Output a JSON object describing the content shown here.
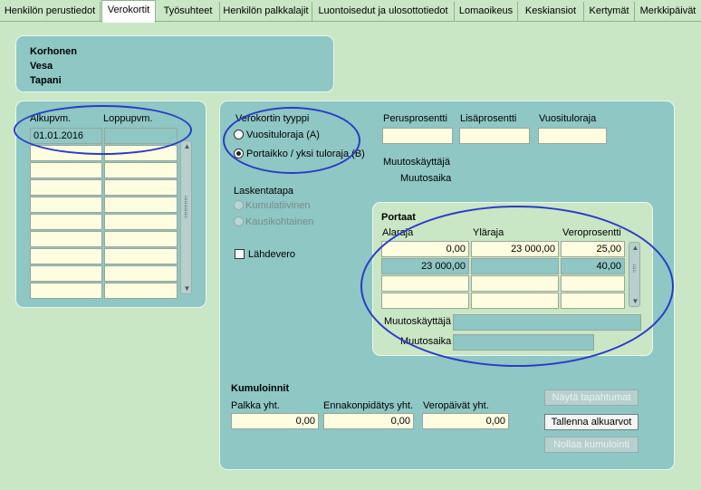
{
  "tabs": [
    {
      "label": "Henkilön perustiedot"
    },
    {
      "label": "Verokortit"
    },
    {
      "label": "Työsuhteet"
    },
    {
      "label": "Henkilön palkkalajit"
    },
    {
      "label": "Luontoisedut ja ulosottotiedot"
    },
    {
      "label": "Lomaoikeus"
    },
    {
      "label": "Keskiansiot"
    },
    {
      "label": "Kertymät"
    },
    {
      "label": "Merkkipäivät"
    }
  ],
  "active_tab": "Verokortit",
  "person": {
    "last_name": "Korhonen",
    "first_name": "Vesa",
    "second_name": "Tapani"
  },
  "cards_list": {
    "col_start": "Alkupvm.",
    "col_end": "Loppupvm.",
    "rows": [
      {
        "start": "01.01.2016",
        "end": ""
      }
    ]
  },
  "card": {
    "type_label": "Verokortin tyyppi",
    "type_options": [
      {
        "label": "Vuosituloraja (A)",
        "selected": false
      },
      {
        "label": "Portaikko / yksi tuloraja (B)",
        "selected": true
      }
    ],
    "basic_percent_label": "Perusprosentti",
    "extra_percent_label": "Lisäprosentti",
    "annual_limit_label": "Vuosituloraja",
    "modifier_label": "Muutoskäyttäjä",
    "modified_label": "Muutosaika",
    "calc_method_label": "Laskentatapa",
    "calc_options": [
      {
        "label": "Kumulatiivinen"
      },
      {
        "label": "Kausikohtainen"
      }
    ],
    "withholding_label": "Lähdevero"
  },
  "steps": {
    "title": "Portaat",
    "col_lower": "Alaraja",
    "col_upper": "Yläraja",
    "col_percent": "Veroprosentti",
    "rows": [
      {
        "lower": "0,00",
        "upper": "23 000,00",
        "percent": "25,00"
      },
      {
        "lower": "23 000,00",
        "upper": "",
        "percent": "40,00"
      }
    ],
    "modifier_label": "Muutoskäyttäjä",
    "modified_label": "Muutosaika"
  },
  "cumulations": {
    "title": "Kumuloinnit",
    "salary_label": "Palkka yht.",
    "salary_value": "0,00",
    "withholding_label": "Ennakonpidätys yht.",
    "withholding_value": "0,00",
    "taxdays_label": "Veropäivät yht.",
    "taxdays_value": "0,00",
    "btn_show_events": "Näytä tapahtumat",
    "btn_save_initial": "Tallenna alkuarvot",
    "btn_reset": "Nollaa kumulointi"
  },
  "colors": {
    "panel": "#8ec7c4",
    "background": "#c9e6c5",
    "field": "#fffde0",
    "annotation": "#2a3bc8"
  }
}
